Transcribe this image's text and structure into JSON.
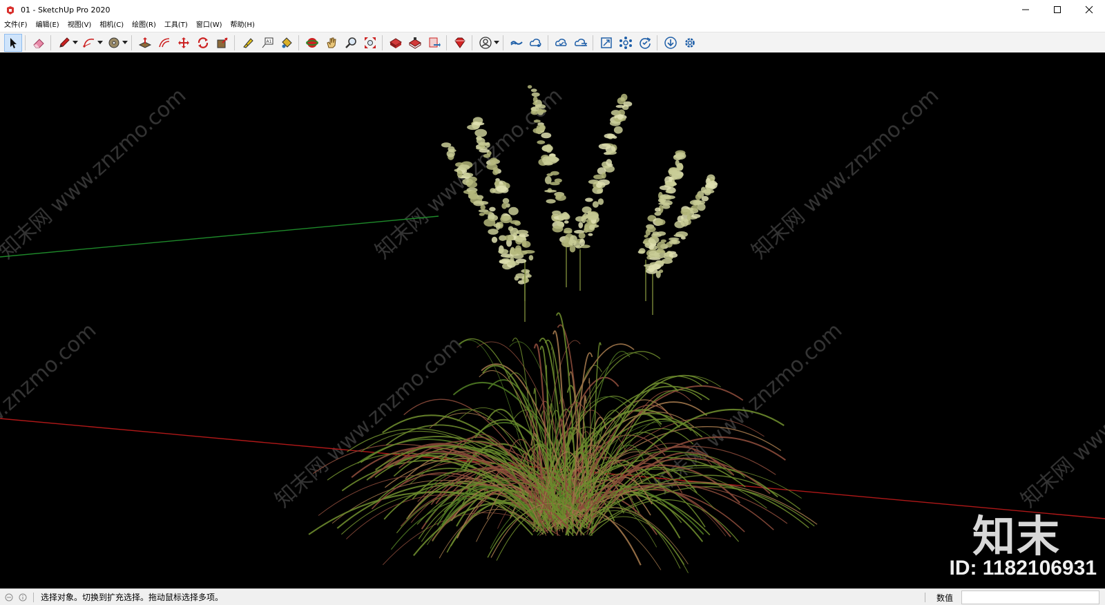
{
  "window": {
    "title": "01 - SketchUp Pro 2020"
  },
  "menu": [
    "文件(F)",
    "编辑(E)",
    "视图(V)",
    "相机(C)",
    "绘图(R)",
    "工具(T)",
    "窗口(W)",
    "帮助(H)"
  ],
  "toolbar": {
    "tools": [
      {
        "name": "select-tool",
        "icon": "arrow-cursor-icon",
        "active": true
      },
      {
        "name": "eraser-tool",
        "icon": "eraser-icon"
      },
      {
        "name": "line-tool",
        "icon": "pencil-icon",
        "dropdown": true
      },
      {
        "name": "arc-tool",
        "icon": "arc-icon",
        "dropdown": true
      },
      {
        "name": "shapes-tool",
        "icon": "circle-shape-icon",
        "dropdown": true
      },
      {
        "name": "push-pull-tool",
        "icon": "push-pull-icon"
      },
      {
        "name": "offset-tool",
        "icon": "offset-icon"
      },
      {
        "name": "move-tool",
        "icon": "move-icon"
      },
      {
        "name": "rotate-tool",
        "icon": "rotate-icon"
      },
      {
        "name": "scale-tool",
        "icon": "scale-icon"
      },
      {
        "name": "tape-measure-tool",
        "icon": "tape-measure-icon"
      },
      {
        "name": "text-tool",
        "icon": "text-icon"
      },
      {
        "name": "paint-bucket-tool",
        "icon": "paint-bucket-icon"
      },
      {
        "name": "orbit-tool",
        "icon": "orbit-icon"
      },
      {
        "name": "pan-tool",
        "icon": "hand-icon"
      },
      {
        "name": "zoom-tool",
        "icon": "magnifier-icon"
      },
      {
        "name": "zoom-extents-tool",
        "icon": "zoom-extents-icon"
      },
      {
        "name": "warehouse-tool",
        "icon": "warehouse-icon"
      },
      {
        "name": "extension-warehouse-tool",
        "icon": "extension-warehouse-icon"
      },
      {
        "name": "send-to-layout-tool",
        "icon": "send-to-layout-icon"
      },
      {
        "name": "extension-manager-tool",
        "icon": "ruby-gem-icon"
      },
      {
        "name": "account-tool",
        "icon": "user-icon",
        "dropdown": true
      },
      {
        "name": "trimble-connect-tool",
        "icon": "connect-icon"
      },
      {
        "name": "trimble-share-tool",
        "icon": "cloud-share-icon"
      },
      {
        "name": "trimble-sync-tool",
        "icon": "cloud-sync-icon"
      },
      {
        "name": "trimble-publish-tool",
        "icon": "cloud-publish-icon"
      },
      {
        "name": "collaborate-tool",
        "icon": "expand-icon"
      },
      {
        "name": "network-tool",
        "icon": "network-icon"
      },
      {
        "name": "refresh-tool",
        "icon": "refresh-check-icon"
      },
      {
        "name": "download-tool",
        "icon": "download-icon"
      },
      {
        "name": "settings-tool",
        "icon": "gear-icon"
      }
    ]
  },
  "viewport": {
    "background": "#000000",
    "axis_colors": {
      "green": "#1e8a2a",
      "red": "#b01818"
    },
    "watermark": "知末网 www.znzmo.com",
    "brand_logo": "知末",
    "brand_id": "ID: 1182106931"
  },
  "status": {
    "message": "选择对象。切换到扩充选择。拖动鼠标选择多项。",
    "measure_label": "数值",
    "measure_value": ""
  }
}
